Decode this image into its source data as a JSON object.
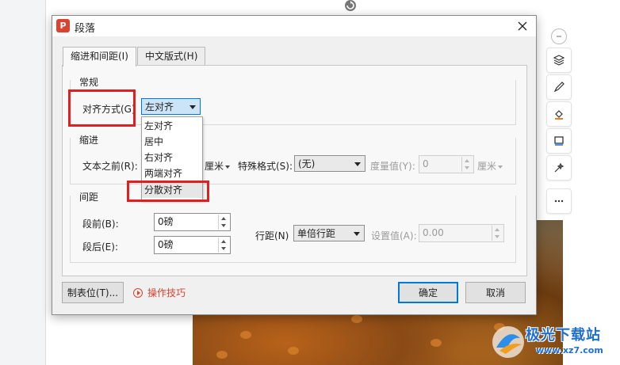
{
  "dialog": {
    "title": "段落",
    "app_icon_letter": "P",
    "tabs": [
      {
        "label": "缩进和间距(I)",
        "active": true
      },
      {
        "label": "中文版式(H)",
        "active": false
      }
    ],
    "general": {
      "group": "常规",
      "align_label": "对齐方式(G)",
      "align_value": "左对齐",
      "align_options": [
        "左对齐",
        "居中",
        "右对齐",
        "两端对齐",
        "分散对齐"
      ],
      "highlighted_option": "分散对齐"
    },
    "indent": {
      "group": "缩进",
      "before_text_label": "文本之前(R):",
      "before_text_unit": "厘米",
      "special_label": "特殊格式(S):",
      "special_value": "(无)",
      "measure_label": "度量值(Y):",
      "measure_value": "0",
      "measure_unit": "厘米"
    },
    "spacing": {
      "group": "间距",
      "before_label": "段前(B):",
      "before_value": "0磅",
      "after_label": "段后(E):",
      "after_value": "0磅",
      "line_label": "行距(N)",
      "line_value": "单倍行距",
      "setting_label": "设置值(A):",
      "setting_value": "0.00"
    },
    "footer": {
      "tabs_button": "制表位(T)...",
      "tips_link": "操作技巧",
      "ok_button": "确定",
      "cancel_button": "取消"
    }
  },
  "watermark": {
    "title": "极光下载站",
    "url": "www.xz7.com"
  },
  "colors": {
    "highlight_red": "#e02020",
    "app_red": "#d9432f",
    "accent_blue": "#0078d7"
  },
  "side_tools": [
    "collapse-icon",
    "layers-icon",
    "brush-icon",
    "fill-icon",
    "frame-icon",
    "magic-icon",
    "more-icon"
  ]
}
